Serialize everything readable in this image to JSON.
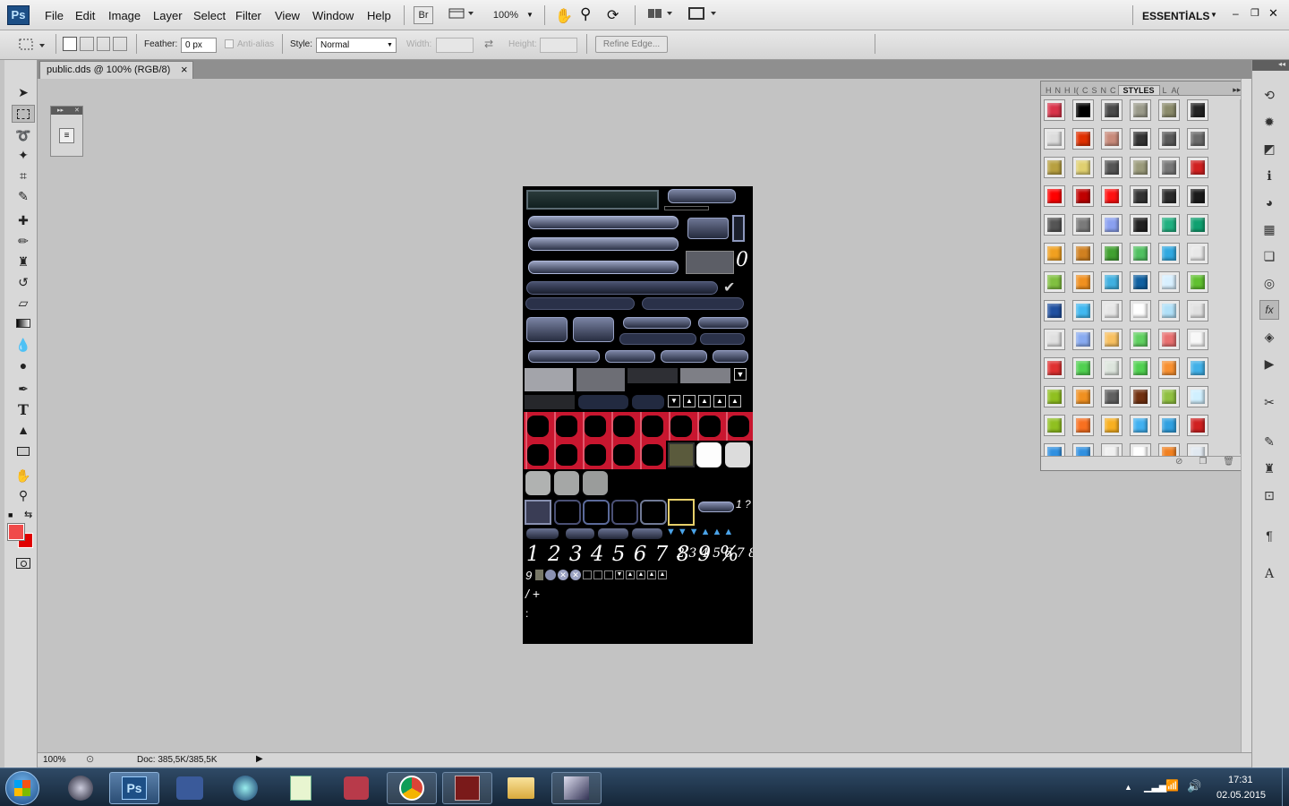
{
  "app": {
    "logo": "Ps",
    "workspace": "ESSENTİALS"
  },
  "menu": [
    "File",
    "Edit",
    "Image",
    "Layer",
    "Select",
    "Filter",
    "View",
    "Window",
    "Help"
  ],
  "appbar": {
    "bridge": "Br",
    "zoom": "100%"
  },
  "options": {
    "feather_label": "Feather:",
    "feather_value": "0 px",
    "antialias_label": "Anti-alias",
    "style_label": "Style:",
    "style_value": "Normal",
    "width_label": "Width:",
    "height_label": "Height:",
    "refine_edge": "Refine Edge..."
  },
  "document": {
    "tab_title": "public.dds @ 100% (RGB/8)",
    "close": "×"
  },
  "colors": {
    "foreground": "#f04a4a",
    "background": "#e00000",
    "accent": "#1d4f86"
  },
  "styles_panel": {
    "tabs": [
      "H",
      "N",
      "H",
      "I(",
      "C",
      "S",
      "N",
      "C",
      "STYLES",
      "L",
      "A("
    ],
    "active_tab": "STYLES",
    "swatches": [
      "#d9334a",
      "#000000",
      "#4a4a4a",
      "#9a9a8a",
      "#8a8a6a",
      "#222222",
      "#dcdcdc",
      "#e03000",
      "#c88a7a",
      "#333333",
      "#5a5a5a",
      "#6a6a6a",
      "#b8a040",
      "#e0d070",
      "#555555",
      "#9a9a7a",
      "#777777",
      "#d02020",
      "#ff0000",
      "#c00000",
      "#ff1010",
      "#333333",
      "#2a2a2a",
      "#1a1a1a",
      "#555555",
      "#7a7a7a",
      "#8aa0f0",
      "#222222",
      "#20b080",
      "#10a070",
      "#f0a020",
      "#d08020",
      "#40a030",
      "#50c060",
      "#30a8e0",
      "#e8e8e8",
      "#80c040",
      "#f09020",
      "#40b0e0",
      "#1060a0",
      "#d8f0ff",
      "#60c030",
      "#2050a0",
      "#40b8f0",
      "#e6e6e6",
      "#ffffff",
      "#b0e0f8",
      "#e0e0e0",
      "#e0e0e0",
      "#88aaf0",
      "#f8c060",
      "#60d060",
      "#e87070",
      "#f8f8f8",
      "#e03030",
      "#50d050",
      "#dde5dd",
      "#50d050",
      "#f89030",
      "#40b0e8",
      "#90c020",
      "#f09020",
      "#606060",
      "#703010",
      "#90c040",
      "#d0f0ff",
      "#90c020",
      "#f87020",
      "#f8b020",
      "#40b0f0",
      "#30a0e0",
      "#d02020",
      "#3090e0",
      "#3090e0",
      "#f0f0f0",
      "#ffffff",
      "#f08020",
      "#e0e8f0"
    ]
  },
  "status": {
    "zoom": "100%",
    "doc": "Doc: 385,5K/385,5K"
  },
  "taskbar": {
    "time": "17:31",
    "date": "02.05.2015",
    "active_app": "Ps"
  },
  "texture": {
    "digits": "1 2 3 4 5 6 7 8 9 %",
    "digits_small": "2 3 4 5 6 7 8",
    "zero": "0",
    "q": "1 ?",
    "nine": "9",
    "slash": "/ +",
    "colon": ":"
  }
}
